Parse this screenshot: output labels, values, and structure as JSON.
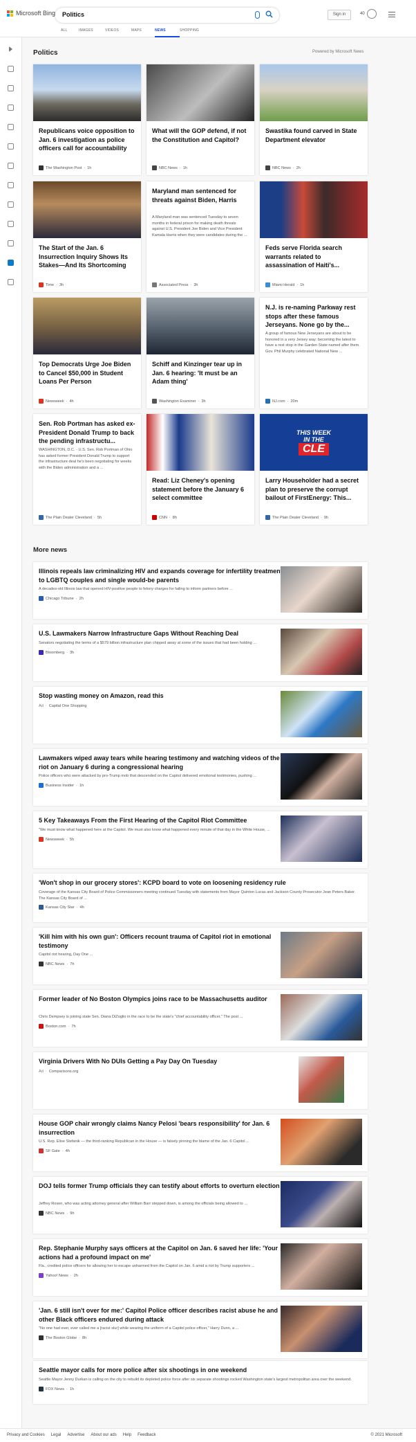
{
  "header": {
    "brand": "Microsoft Bing",
    "search_value": "Politics",
    "signin_label": "Sign in",
    "points": "40",
    "tabs": [
      {
        "label": "ALL",
        "active": false
      },
      {
        "label": "IMAGES",
        "active": false
      },
      {
        "label": "VIDEOS",
        "active": false
      },
      {
        "label": "MAPS",
        "active": false
      },
      {
        "label": "NEWS",
        "active": true
      },
      {
        "label": "SHOPPING",
        "active": false
      }
    ]
  },
  "colors": {
    "accent": "#174ae4",
    "ms_red": "#f25022",
    "ms_green": "#7fba00",
    "ms_blue": "#00a4ef",
    "ms_yellow": "#ffb900"
  },
  "section": {
    "title": "Politics",
    "powered_by": "Powered by Microsoft News"
  },
  "cards": [
    {
      "title": "Republicans voice opposition to Jan. 6 investigation as police officers call for accountability",
      "desc": "",
      "source": "The Washington Post",
      "age": "1h",
      "icon": "capitol-photo"
    },
    {
      "title": "What will the GOP defend, if not the Constitution and Capitol?",
      "desc": "",
      "source": "NBC News",
      "age": "1h",
      "icon": "speaker-photo"
    },
    {
      "title": "Swastika found carved in State Department elevator",
      "desc": "",
      "source": "NBC News",
      "age": "2h",
      "icon": "building-photo"
    },
    {
      "title": "The Start of the Jan. 6 Insurrection Inquiry Shows Its Stakes—And Its Shortcoming",
      "desc": "",
      "source": "Time",
      "age": "3h",
      "icon": "hearing-photo"
    },
    {
      "title": "Maryland man sentenced for threats against Biden, Harris",
      "desc": "A Maryland man was sentenced Tuesday to seven months in federal prison for making death threats against U.S. President Joe Biden and Vice President Kamala Harris when they were candidates during the ...",
      "source": "Associated Press",
      "age": "3h",
      "icon": ""
    },
    {
      "title": "Feds serve Florida search warrants related to assassination of Haiti's...",
      "desc": "",
      "source": "Miami Herald",
      "age": "1h",
      "icon": "portrait-photo"
    },
    {
      "title": "Top Democrats Urge Joe Biden to Cancel $50,000 in Student Loans Per Person",
      "desc": "",
      "source": "Newsweek",
      "age": "4h",
      "icon": "senator-photo"
    },
    {
      "title": "Schiff and Kinzinger tear up in Jan. 6 hearing: 'It must be an Adam thing'",
      "desc": "",
      "source": "Washington Examiner",
      "age": "3h",
      "icon": "lawmakers-photo"
    },
    {
      "title": "N.J. is re-naming Parkway rest stops after these famous Jerseyans. None go by the...",
      "desc": "A group of famous New Jerseyans are about to be honored in a very Jersey way: becoming the latest to have a rest stop in the Garden State named after them. Gov. Phil Murphy celebrated National New ...",
      "source": "NJ.com",
      "age": "20m",
      "icon": ""
    },
    {
      "title": "Sen. Rob Portman has asked ex-President Donald Trump to back the pending infrastructu...",
      "desc": "WASHINGTON, D.C. - U.S. Sen. Rob Portman of Ohio has asked former President Donald Trump to support the infrastructure deal he's been negotiating for weeks with the Biden administration and a ...",
      "source": "The Plain Dealer Cleveland",
      "age": "5h",
      "icon": ""
    },
    {
      "title": "Read: Liz Cheney's opening statement before the January 6 select committee",
      "desc": "",
      "source": "CNN",
      "age": "8h",
      "icon": "cheney-photo"
    },
    {
      "title": "Larry Householder had a secret plan to preserve the corrupt bailout of FirstEnergy: This...",
      "desc": "",
      "source": "The Plain Dealer Cleveland",
      "age": "9h",
      "icon": "this-week-in-cle-logo",
      "image_text": [
        "THIS WEEK",
        "IN THE",
        "CLE"
      ]
    }
  ],
  "more_news": {
    "title": "More news",
    "items": [
      {
        "title": "Illinois repeals law criminalizing HIV and expands coverage for infertility treatment to LGBTQ couples and single would-be parents",
        "desc": "A decades-old Illinois law that opened HIV-positive people to felony charges for failing to inform partners before ...",
        "source": "Chicago Tribune",
        "age": "2h",
        "ad": false
      },
      {
        "title": "U.S. Lawmakers Narrow Infrastructure Gaps Without Reaching Deal",
        "desc": "Senators negotiating the terms of a $579 billion infrastructure plan chipped away at some of the issues that had been holding ...",
        "source": "Bloomberg",
        "age": "3h",
        "ad": false
      },
      {
        "title": "Stop wasting money on Amazon, read this",
        "desc": "",
        "source": "Capital One Shopping",
        "age": "",
        "ad": true,
        "ad_label": "Ad"
      },
      {
        "title": "Lawmakers wiped away tears while hearing testimony and watching videos of the riot on January 6 during a congressional hearing",
        "desc": "Police officers who were attacked by pro-Trump mob that descended on the Capitol delivered emotional testimonies, pushing ...",
        "source": "Business Insider",
        "age": "1h",
        "ad": false
      },
      {
        "title": "5 Key Takeaways From the First Hearing of the Capitol Riot Committee",
        "desc": "\"We must know what happened here at the Capitol. We must also know what happened every minute of that day in the White House, ...",
        "source": "Newsweek",
        "age": "5h",
        "ad": false
      },
      {
        "title": "'Won't shop in our grocery stores': KCPD board to vote on loosening residency rule",
        "desc": "Coverage of the Kansas City Board of Police Commissioners meeting continued Tuesday with statements from Mayor Quinton Lucas and Jackson County Prosecutor Jean Peters Baker. The Kansas City Board of ...",
        "source": "Kansas City Star",
        "age": "4h",
        "ad": false
      },
      {
        "title": "'Kill him with his own gun': Officers recount trauma of Capitol riot in emotional testimony",
        "desc": "Capitol riot hearing, Day One ...",
        "source": "NBC News",
        "age": "7h",
        "ad": false
      },
      {
        "title": "Former leader of No Boston Olympics joins race to be Massachusetts auditor",
        "desc": "Chris Dempsey is joining state Sen. Diana DiZoglio in the race to be the state's \"chief accountability officer.\" The post ...",
        "source": "Boston.com",
        "age": "7h",
        "ad": false
      },
      {
        "title": "Virginia Drivers With No DUIs Getting a Pay Day On Tuesday",
        "desc": "",
        "source": "Comparisons.org",
        "age": "",
        "ad": true,
        "ad_label": "Ad"
      },
      {
        "title": "House GOP chair wrongly claims Nancy Pelosi 'bears responsibility' for Jan. 6 insurrection",
        "desc": "U.S. Rep. Elise Stefanik — the third-ranking Republican in the House — is falsely pinning the blame of the Jan. 6 Capitol ...",
        "source": "SF Gate",
        "age": "4h",
        "ad": false
      },
      {
        "title": "DOJ tells former Trump officials they can testify about efforts to overturn election",
        "desc": "Jeffrey Rosen, who was acting attorney general after William Barr stepped down, is among the officials being allowed to ...",
        "source": "NBC News",
        "age": "9h",
        "ad": false
      },
      {
        "title": "Rep. Stephanie Murphy says officers at the Capitol on Jan. 6 saved her life: 'Your actions had a profound impact on me'",
        "desc": "Fla., credited police officers for allowing her to escape unharmed from the Capitol on Jan. 6 amid a riot by Trump supporters ...",
        "source": "Yahoo! News",
        "age": "2h",
        "ad": false
      },
      {
        "title": "'Jan. 6 still isn't over for me:' Capitol Police officer describes racist abuse he and other Black officers endured during attack",
        "desc": "\"No one had ever, ever called me a [racist slur] while wearing the uniform of a Capitol police officer,\" Harry Dunn, a ...",
        "source": "The Boston Globe",
        "age": "8h",
        "ad": false
      },
      {
        "title": "Seattle mayor calls for more police after six shootings in one weekend",
        "desc": "Seattle Mayor Jenny Durkan is calling on the city to rebuild its depleted police force after six separate shootings rocked Washington state's largest metropolitan area over the weekend.",
        "source": "FOX News",
        "age": "1h",
        "ad": false
      }
    ]
  },
  "footer": {
    "links": [
      "Privacy and Cookies",
      "Legal",
      "Advertise",
      "About our ads",
      "Help",
      "Feedback"
    ],
    "copyright": "© 2021 Microsoft"
  }
}
